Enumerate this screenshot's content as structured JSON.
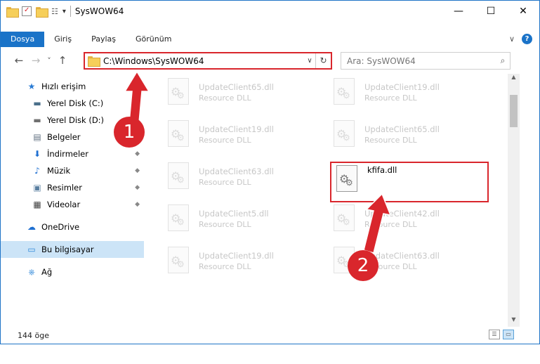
{
  "titlebar": {
    "title": "SysWOW64",
    "dropdown_glyph": "▾",
    "controls": {
      "minimize": "—",
      "maximize": "☐",
      "close": "✕"
    }
  },
  "ribbon": {
    "tabs": [
      {
        "label": "Dosya",
        "active": true
      },
      {
        "label": "Giriş",
        "active": false
      },
      {
        "label": "Paylaş",
        "active": false
      },
      {
        "label": "Görünüm",
        "active": false
      }
    ],
    "expand_glyph": "∨",
    "help_glyph": "?"
  },
  "navigation": {
    "back": "←",
    "forward": "→",
    "recent": "˅",
    "up": "↑"
  },
  "address": {
    "path": "C:\\Windows\\SysWOW64",
    "dropdown_glyph": "∨",
    "refresh_glyph": "↻"
  },
  "search": {
    "placeholder": "Ara: SysWOW64",
    "icon_glyph": "⌕"
  },
  "sidebar": {
    "items": [
      {
        "label": "Hızlı erişim",
        "icon": "star-icon",
        "glyph": "★",
        "color": "#2a7bd4",
        "pinned": false
      },
      {
        "label": "Yerel Disk (C:)",
        "icon": "drive-icon",
        "glyph": "▬",
        "color": "#4a6f8a",
        "pinned": true
      },
      {
        "label": "Yerel Disk (D:)",
        "icon": "drive-icon",
        "glyph": "▬",
        "color": "#707070",
        "pinned": true
      },
      {
        "label": "Belgeler",
        "icon": "document-icon",
        "glyph": "▤",
        "color": "#607080",
        "pinned": true
      },
      {
        "label": "İndirmeler",
        "icon": "download-icon",
        "glyph": "⬇",
        "color": "#1e6fd1",
        "pinned": true
      },
      {
        "label": "Müzik",
        "icon": "music-icon",
        "glyph": "♪",
        "color": "#1e6fd1",
        "pinned": true
      },
      {
        "label": "Resimler",
        "icon": "pictures-icon",
        "glyph": "▣",
        "color": "#5a7fa0",
        "pinned": true
      },
      {
        "label": "Videolar",
        "icon": "video-icon",
        "glyph": "▦",
        "color": "#404040",
        "pinned": true
      },
      {
        "label": "OneDrive",
        "icon": "cloud-icon",
        "glyph": "☁",
        "color": "#1e6fd1",
        "pinned": false
      },
      {
        "label": "Bu bilgisayar",
        "icon": "computer-icon",
        "glyph": "▭",
        "color": "#2f88d9",
        "pinned": false
      },
      {
        "label": "Ağ",
        "icon": "network-icon",
        "glyph": "⎈",
        "color": "#2f88d9",
        "pinned": false
      }
    ],
    "pin_glyph": "📌"
  },
  "files": [
    {
      "name": "UpdateClient65.dll",
      "type": "Resource DLL"
    },
    {
      "name": "UpdateClient19.dll",
      "type": "Resource DLL"
    },
    {
      "name": "UpdateClient19.dll",
      "type": "Resource DLL"
    },
    {
      "name": "UpdateClient65.dll",
      "type": "Resource DLL"
    },
    {
      "name": "UpdateClient63.dll",
      "type": "Resource DLL"
    },
    {
      "name": "kfifa.dll",
      "type": ""
    },
    {
      "name": "UpdateClient5.dll",
      "type": "Resource DLL"
    },
    {
      "name": "UpdateClient42.dll",
      "type": "Resource DLL"
    },
    {
      "name": "UpdateClient19.dll",
      "type": "Resource DLL"
    },
    {
      "name": "UpdateClient63.dll",
      "type": "Resource DLL"
    }
  ],
  "status": {
    "item_count": "144 öge"
  },
  "annotations": {
    "step1": "1",
    "step2": "2",
    "color": "#d9262c"
  },
  "view_buttons": {
    "details": "☰",
    "large_icons": "▭"
  }
}
